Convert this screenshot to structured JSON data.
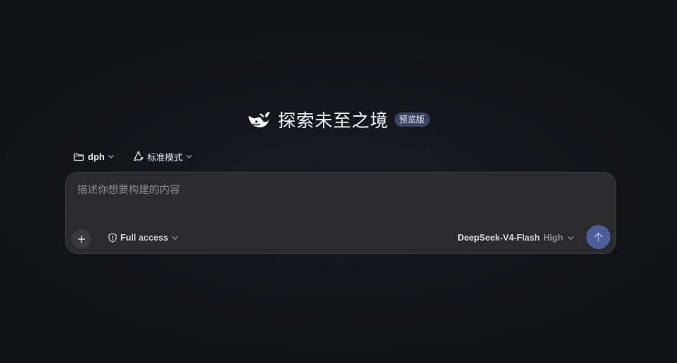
{
  "hero": {
    "title": "探索未至之境",
    "badge": "预览版",
    "logo_icon": "whale-logo-icon"
  },
  "selectors": {
    "project": {
      "icon": "folder-icon",
      "label": "dph"
    },
    "mode": {
      "icon": "recycle-icon",
      "label": "标准模式"
    }
  },
  "composer": {
    "placeholder": "描述你想要构建的内容",
    "value": "",
    "access": {
      "icon": "shield-icon",
      "label": "Full access"
    },
    "model": {
      "name": "DeepSeek-V4-Flash",
      "effort": "High"
    },
    "send_icon": "arrow-up-icon",
    "attach_icon": "plus-icon"
  },
  "colors": {
    "background": "#15161b",
    "composer": "#2b2b2e",
    "badge": "#3a4363",
    "send": "#4a5e9c"
  }
}
